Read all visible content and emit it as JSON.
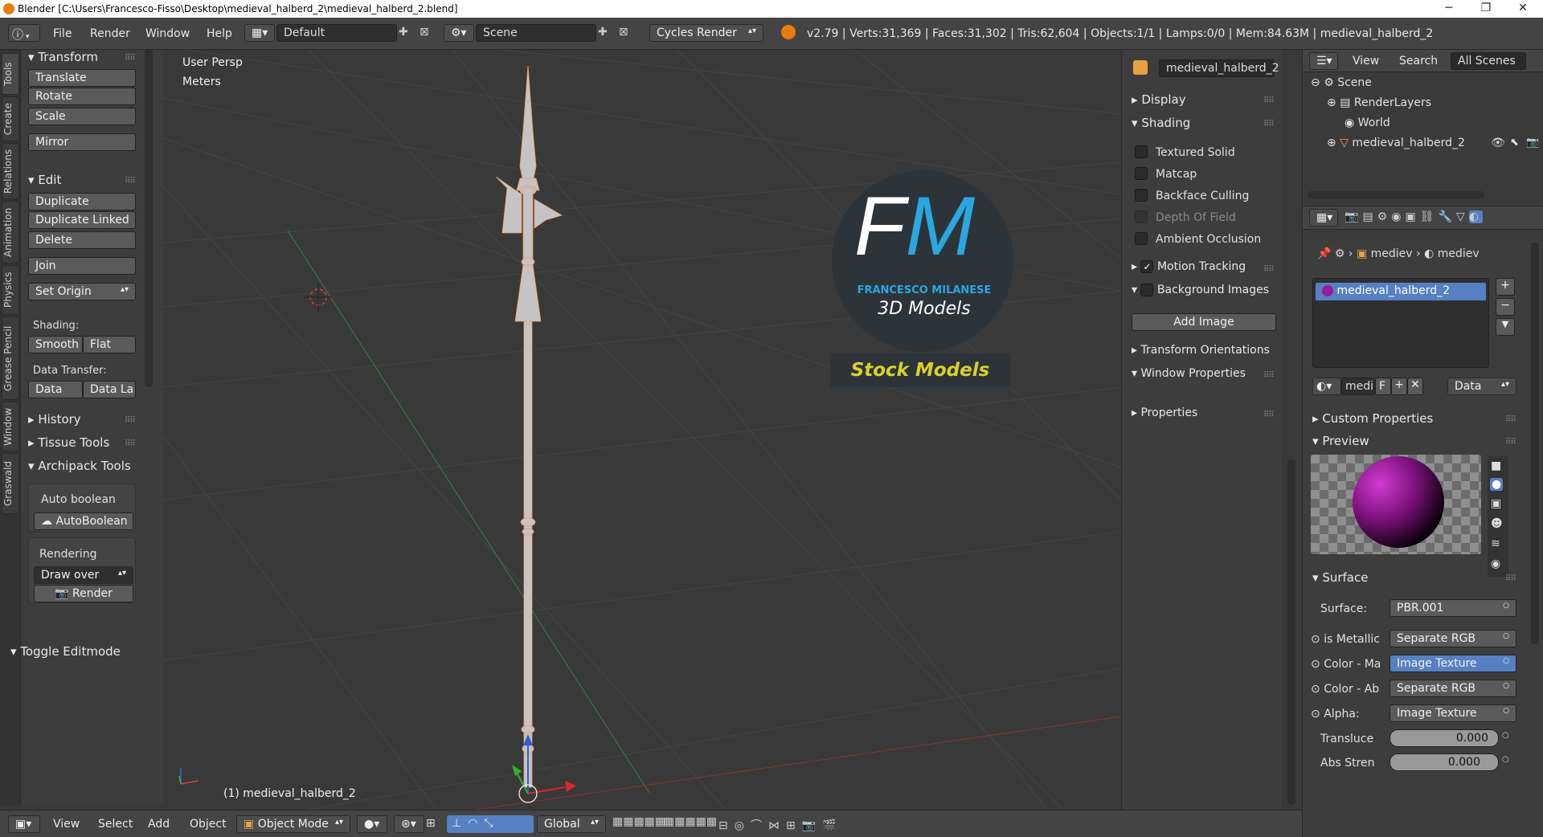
{
  "window": {
    "title": "Blender [C:\\Users\\Francesco-Fisso\\Desktop\\medieval_halberd_2\\medieval_halberd_2.blend]",
    "minimize": "─",
    "maximize": "❐",
    "close": "✕"
  },
  "infobar": {
    "menus": [
      "File",
      "Render",
      "Window",
      "Help"
    ],
    "layout": "Default",
    "scene": "Scene",
    "engine": "Cycles Render",
    "stats": "v2.79 | Verts:31,369 | Faces:31,302 | Tris:62,604 | Objects:1/1 | Lamps:0/0 | Mem:84.63M | medieval_halberd_2"
  },
  "left_tabs": [
    "Tools",
    "Create",
    "Relations",
    "Animation",
    "Physics",
    "Grease Pencil",
    "Window",
    "Graswald"
  ],
  "toolshelf": {
    "transform_title": "Transform",
    "translate": "Translate",
    "rotate": "Rotate",
    "scale": "Scale",
    "mirror": "Mirror",
    "edit_title": "Edit",
    "duplicate": "Duplicate",
    "duplicate_linked": "Duplicate Linked",
    "delete": "Delete",
    "join": "Join",
    "set_origin": "Set Origin",
    "shading_label": "Shading:",
    "smooth": "Smooth",
    "flat": "Flat",
    "data_transfer_label": "Data Transfer:",
    "data": "Data",
    "data_la": "Data La",
    "history": "History",
    "tissue_tools": "Tissue Tools",
    "archipack_tools": "Archipack Tools",
    "auto_boolean_label": "Auto boolean",
    "auto_boolean_btn": "AutoBoolean",
    "rendering_label": "Rendering",
    "draw_over": "Draw over",
    "render_btn": "Render",
    "toggle_editmode": "Toggle Editmode"
  },
  "viewport": {
    "view_name": "User Persp",
    "units": "Meters",
    "object_label": "(1) medieval_halberd_2",
    "watermark": {
      "letters_f": "F",
      "letters_m": "M",
      "name": "FRANCESCO MILANESE",
      "sub": "3D Models",
      "stock": "Stock Models"
    }
  },
  "npanel": {
    "object_name": "medieval_halberd_2",
    "display": "Display",
    "shading": "Shading",
    "textured_solid": "Textured Solid",
    "matcap": "Matcap",
    "backface_culling": "Backface Culling",
    "depth_of_field": "Depth Of Field",
    "ambient_occlusion": "Ambient Occlusion",
    "motion_tracking": "Motion Tracking",
    "background_images": "Background Images",
    "add_image": "Add Image",
    "transform_orientations": "Transform Orientations",
    "window_properties": "Window Properties",
    "properties": "Properties"
  },
  "outliner": {
    "view": "View",
    "search": "Search",
    "all_scenes": "All Scenes",
    "scene": "Scene",
    "render_layers": "RenderLayers",
    "world": "World",
    "object": "medieval_halberd_2"
  },
  "properties": {
    "breadcrumb_obj": "mediev",
    "breadcrumb_mat": "mediev",
    "material_slot": "medieval_halberd_2",
    "mat_short": "medi",
    "mat_f": "F",
    "data": "Data",
    "custom_properties": "Custom Properties",
    "preview": "Preview",
    "surface_section": "Surface",
    "surface_label": "Surface:",
    "surface_value": "PBR.001",
    "rows": [
      {
        "label": "is Metallic",
        "value": "Separate RGB"
      },
      {
        "label": "Color - Ma",
        "value": "Image Texture"
      },
      {
        "label": "Color - Ab",
        "value": "Separate RGB"
      },
      {
        "label": "Alpha:",
        "value": "Image Texture"
      }
    ],
    "translucence_label": "Transluce",
    "translucence_value": "0.000",
    "abs_label": "Abs Stren",
    "abs_value": "0.000"
  },
  "bottombar": {
    "view": "View",
    "select": "Select",
    "add": "Add",
    "object": "Object",
    "mode": "Object Mode",
    "orientation": "Global"
  },
  "colors": {
    "accent_blue": "#5680c2",
    "watermark_blue": "#2aa7df",
    "stock_yellow": "#d9d12a",
    "grid": "#454545"
  }
}
